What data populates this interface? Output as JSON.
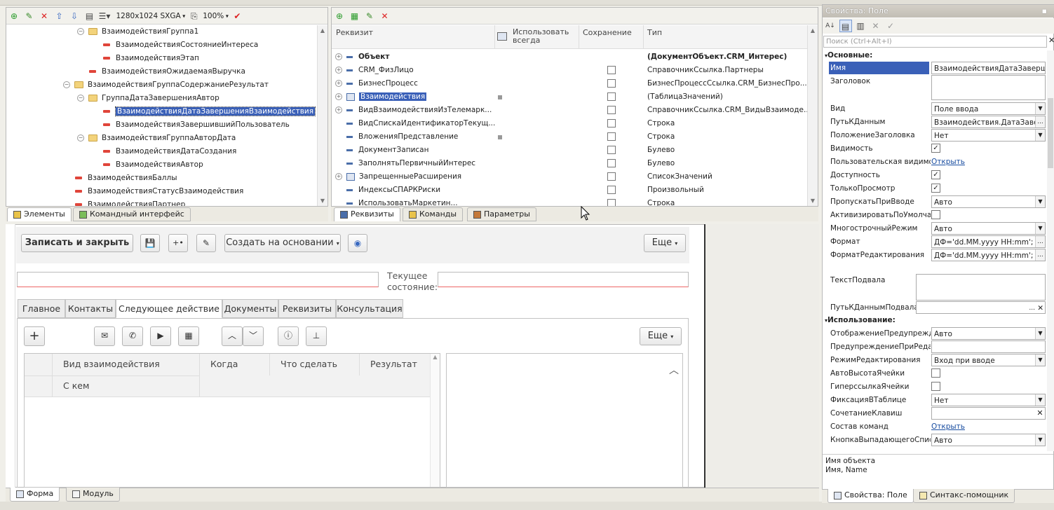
{
  "top_toolbar": {
    "resolution": "1280x1024 SXGA",
    "zoom": "100%"
  },
  "tree": {
    "items": [
      {
        "label": "ВзаимодействияГруппа1",
        "kind": "folder",
        "toggle": "−",
        "indent": 1
      },
      {
        "label": "ВзаимодействияСостояниеИнтереса",
        "kind": "field",
        "indent": 2
      },
      {
        "label": "ВзаимодействияЭтап",
        "kind": "field",
        "indent": 2
      },
      {
        "label": "ВзаимодействияОжидаемаяВыручка",
        "kind": "field",
        "indent": 1
      },
      {
        "label": "ВзаимодействияГруппаСодержаниеРезультат",
        "kind": "folder",
        "toggle": "−",
        "indent": 0
      },
      {
        "label": "ГруппаДатаЗавершенияАвтор",
        "kind": "folder",
        "toggle": "−",
        "indent": 1
      },
      {
        "label": "ВзаимодействияДатаЗавершенияВзаимодействия",
        "kind": "field",
        "indent": 2,
        "selected": true
      },
      {
        "label": "ВзаимодействияЗавершившийПользователь",
        "kind": "field",
        "indent": 2
      },
      {
        "label": "ВзаимодействияГруппаАвторДата",
        "kind": "folder",
        "toggle": "−",
        "indent": 1
      },
      {
        "label": "ВзаимодействияДатаСоздания",
        "kind": "field",
        "indent": 2
      },
      {
        "label": "ВзаимодействияАвтор",
        "kind": "field",
        "indent": 2
      },
      {
        "label": "ВзаимодействияБаллы",
        "kind": "field",
        "indent": 0
      },
      {
        "label": "ВзаимодействияСтатусВзаимодействия",
        "kind": "field",
        "indent": 0
      },
      {
        "label": "ВзаимодействияПартнер",
        "kind": "field",
        "indent": 0
      }
    ],
    "tabs": [
      "Элементы",
      "Командный интерфейс"
    ]
  },
  "attrs": {
    "headers": {
      "name": "Реквизит",
      "always": "Использовать всегда",
      "save": "Сохранение",
      "type": "Тип"
    },
    "rows": [
      {
        "name": "Объект",
        "type": "(ДокументОбъект.CRM_Интерес)",
        "bold": true,
        "plus": true,
        "save": false,
        "always": false
      },
      {
        "name": "CRM_ФизЛицо",
        "type": "СправочникСсылка.Партнеры",
        "plus": true,
        "save": true,
        "always": false
      },
      {
        "name": "БизнесПроцесс",
        "type": "БизнесПроцессСсылка.CRM_БизнесПро...",
        "plus": true,
        "save": true,
        "always": false
      },
      {
        "name": "Взаимодействия",
        "type": "(ТаблицаЗначений)",
        "plus": true,
        "save": true,
        "always": true,
        "selected": true,
        "table": true
      },
      {
        "name": "ВидВзаимодействияИзТелемарк...",
        "type": "СправочникСсылка.CRM_ВидыВзаимоде...",
        "plus": true,
        "save": true,
        "always": false
      },
      {
        "name": "ВидСпискаИдентификаторТекущ...",
        "type": "Строка",
        "plus": false,
        "save": true,
        "always": false
      },
      {
        "name": "ВложенияПредставление",
        "type": "Строка",
        "plus": false,
        "save": true,
        "always": true
      },
      {
        "name": "ДокументЗаписан",
        "type": "Булево",
        "plus": false,
        "save": true,
        "always": false
      },
      {
        "name": "ЗаполнятьПервичныйИнтерес",
        "type": "Булево",
        "plus": false,
        "save": true,
        "always": false
      },
      {
        "name": "ЗапрещенныеРасширения",
        "type": "СписокЗначений",
        "plus": true,
        "save": true,
        "always": false,
        "table": true
      },
      {
        "name": "ИндексыСПАРКРиски",
        "type": "Произвольный",
        "plus": false,
        "save": true,
        "always": false
      },
      {
        "name": "ИспользоватьМаркетин...",
        "type": "Строка",
        "plus": false,
        "save": true,
        "always": false
      }
    ],
    "tabs": [
      "Реквизиты",
      "Команды",
      "Параметры"
    ]
  },
  "form": {
    "save_close": "Записать и закрыть",
    "create_based": "Создать на основании",
    "more": "Еще",
    "state_label_1": "Текущее",
    "state_label_2": "состояние:",
    "tabs": [
      "Главное",
      "Контакты",
      "Следующее действие",
      "Документы",
      "Реквизиты",
      "Консультация"
    ],
    "inner_more": "Еще",
    "cols": {
      "kind": "Вид взаимодействия",
      "when": "Когда",
      "what": "Что сделать",
      "result": "Результат",
      "with": "С кем"
    },
    "bottom_tabs": [
      "Форма",
      "Модуль"
    ]
  },
  "props": {
    "title": "Свойства: Поле",
    "search_placeholder": "Поиск (Ctrl+Alt+I)",
    "section_main": "Основные:",
    "section_use": "Использование:",
    "rows": [
      {
        "label": "Имя",
        "value": "ВзаимодействияДатаЗавершения",
        "type": "text",
        "selected": true
      },
      {
        "label": "Заголовок",
        "value": "",
        "type": "big"
      },
      {
        "label": "Вид",
        "value": "Поле ввода",
        "type": "dd"
      },
      {
        "label": "ПутьКДанным",
        "value": "Взаимодействия.ДатаЗавер",
        "type": "dots"
      },
      {
        "label": "ПоложениеЗаголовка",
        "value": "Нет",
        "type": "dd"
      },
      {
        "label": "Видимость",
        "value": "✓",
        "type": "chk"
      },
      {
        "label": "Пользовательская видимость",
        "value": "Открыть",
        "type": "link"
      },
      {
        "label": "Доступность",
        "value": "✓",
        "type": "chk"
      },
      {
        "label": "ТолькоПросмотр",
        "value": "✓",
        "type": "chk"
      },
      {
        "label": "ПропускатьПриВводе",
        "value": "Авто",
        "type": "dd"
      },
      {
        "label": "АктивизироватьПоУмолчанию",
        "value": "",
        "type": "chk"
      },
      {
        "label": "МногострочныйРежим",
        "value": "Авто",
        "type": "dd"
      },
      {
        "label": "Формат",
        "value": "ДФ='dd.MM.yyyy HH:mm'; ДЛ",
        "type": "dots"
      },
      {
        "label": "ФорматРедактирования",
        "value": "ДФ='dd.MM.yyyy HH:mm'; ДЛ",
        "type": "dots"
      }
    ],
    "footer_text": {
      "label": "ТекстПодвала"
    },
    "footer_path": {
      "label": "ПутьКДаннымПодвала"
    },
    "use_rows": [
      {
        "label": "ОтображениеПредупреждения",
        "value": "Авто",
        "type": "dd"
      },
      {
        "label": "ПредупреждениеПриРедактировании",
        "value": "",
        "type": "text"
      },
      {
        "label": "РежимРедактирования",
        "value": "Вход при вводе",
        "type": "dd"
      },
      {
        "label": "АвтоВысотаЯчейки",
        "value": "",
        "type": "chk"
      },
      {
        "label": "ГиперссылкаЯчейки",
        "value": "",
        "type": "chk"
      },
      {
        "label": "ФиксацияВТаблице",
        "value": "Нет",
        "type": "dd"
      },
      {
        "label": "СочетаниеКлавиш",
        "value": "",
        "type": "x"
      },
      {
        "label": "Состав команд",
        "value": "Открыть",
        "type": "link"
      },
      {
        "label": "КнопкаВыпадающегоСписка",
        "value": "Авто",
        "type": "dd"
      }
    ],
    "desc_title": "Имя объекта",
    "desc_text": "Имя, Name",
    "bottom_tabs": [
      "Свойства: Поле",
      "Синтакс-помощник"
    ]
  }
}
